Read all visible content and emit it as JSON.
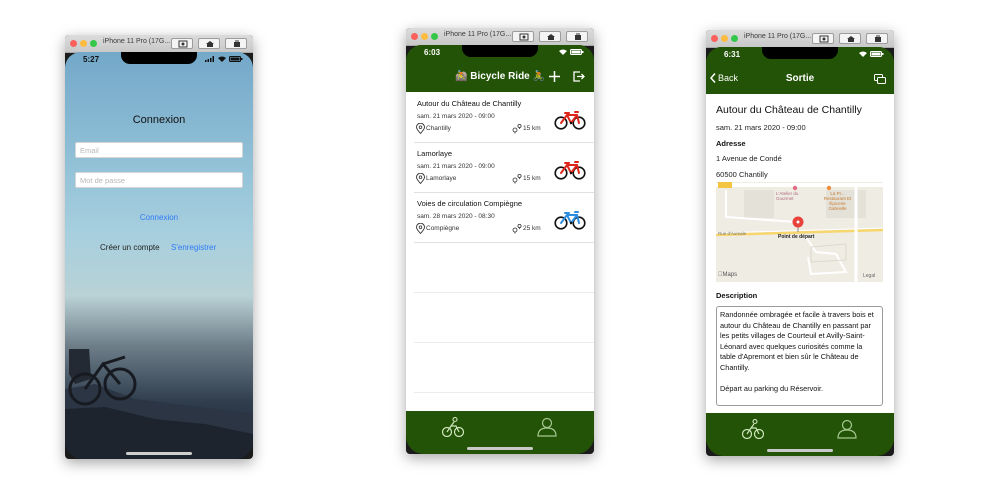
{
  "simulators": [
    {
      "title": "iPhone 11 Pro (17G..."
    },
    {
      "title": "iPhone 11 Pro (17G..."
    },
    {
      "title": "iPhone 11 Pro (17G..."
    }
  ],
  "login": {
    "time": "5:27",
    "title": "Connexion",
    "email_placeholder": "Email",
    "password_placeholder": "Mot de passe",
    "connect_label": "Connexion",
    "create_label": "Créer un compte",
    "register_label": "S'enregistrer"
  },
  "list": {
    "time": "6:03",
    "title": "🚵 Bicycle Ride 🚴",
    "rides": [
      {
        "title": "Autour du Château de Chantilly",
        "date": "sam. 21 mars 2020 - 09:00",
        "city": "Chantilly",
        "distance": "15 km",
        "bike_color": "#e0261b"
      },
      {
        "title": "Lamorlaye",
        "date": "sam. 21 mars 2020 - 09:00",
        "city": "Lamorlaye",
        "distance": "15 km",
        "bike_color": "#e0261b"
      },
      {
        "title": "Voies de circulation Compiègne",
        "date": "sam. 28 mars 2020 - 08:30",
        "city": "Compiègne",
        "distance": "25 km",
        "bike_color": "#2e8ee0"
      }
    ]
  },
  "detail": {
    "time": "6:31",
    "back_label": "Back",
    "title": "Sortie",
    "ride_title": "Autour du Château de Chantilly",
    "date": "sam. 21 mars 2020 - 09:00",
    "address_label": "Adresse",
    "address_line1": "1 Avenue de Condé",
    "address_line2": "60500 Chantilly",
    "map": {
      "pin_label": "Point de départ",
      "road_left": "Rue d'Aumale",
      "poi1": "L'Atelier du Gourmet",
      "poi2": "La Pr... Restaurant Et Épicerie Gabrielle",
      "maps_label": "Maps",
      "legal_label": "Legal"
    },
    "description_label": "Description",
    "description": "Randonnée ombragée et facile à travers bois et autour du Château de Chantilly en passant par les petits villages de Courteuil et Avilly-Saint-Léonard avec quelques curiosités comme la table d'Apremont et bien sûr le Château de Chantilly.",
    "description_extra": "Départ au parking du Réservoir."
  },
  "colors": {
    "nav_green": "#235306",
    "link_blue": "#2f7bf5"
  }
}
